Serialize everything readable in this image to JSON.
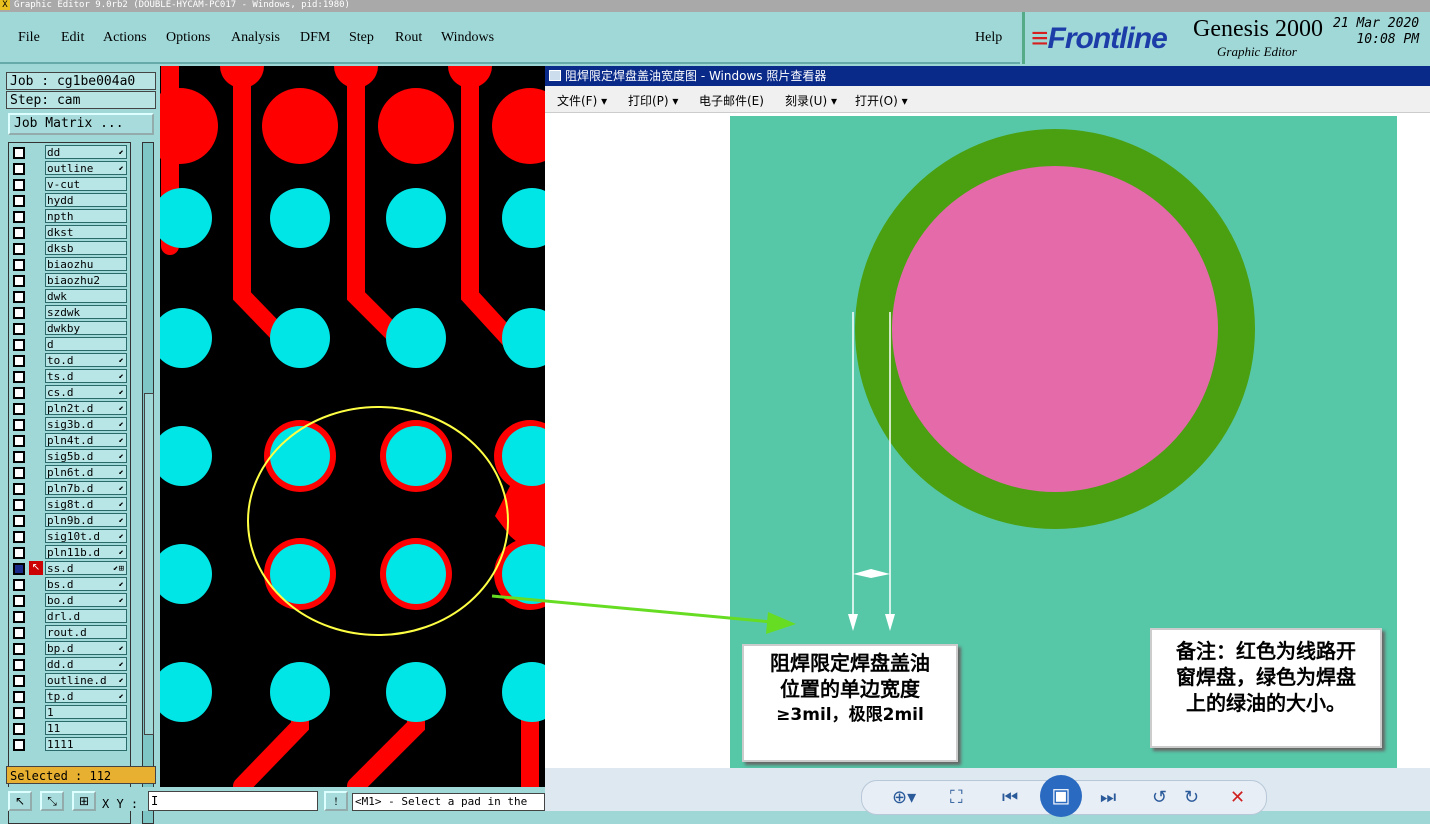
{
  "window": {
    "title": "Graphic Editor 9.0rb2 (DOUBLE-HYCAM-PC017 - Windows, pid:1980)",
    "app_icon_glyph": "X"
  },
  "menubar": {
    "items": [
      {
        "label": "File"
      },
      {
        "label": "Edit"
      },
      {
        "label": "Actions"
      },
      {
        "label": "Options"
      },
      {
        "label": "Analysis"
      },
      {
        "label": "DFM"
      },
      {
        "label": "Step"
      },
      {
        "label": "Rout"
      },
      {
        "label": "Windows"
      }
    ],
    "help": "Help"
  },
  "brand": {
    "logo": "Frontline",
    "product": "Genesis 2000",
    "subtitle": "Graphic Editor",
    "date": "21 Mar 2020",
    "time": "10:08 PM"
  },
  "leftpanel": {
    "job": "Job : cg1be004a0",
    "step": "Step: cam",
    "job_matrix_button": "Job Matrix ...",
    "selected": "Selected : 112",
    "layers": [
      {
        "name": "dd",
        "mark": "⬋"
      },
      {
        "name": "outline",
        "mark": "⬋"
      },
      {
        "name": "v-cut",
        "mark": ""
      },
      {
        "name": "hydd",
        "mark": ""
      },
      {
        "name": "npth",
        "mark": ""
      },
      {
        "name": "dkst",
        "mark": ""
      },
      {
        "name": "dksb",
        "mark": ""
      },
      {
        "name": "biaozhu",
        "mark": ""
      },
      {
        "name": "biaozhu2",
        "mark": ""
      },
      {
        "name": "dwk",
        "mark": ""
      },
      {
        "name": "szdwk",
        "mark": ""
      },
      {
        "name": "dwkby",
        "mark": ""
      },
      {
        "name": "d",
        "mark": ""
      },
      {
        "name": "to.d",
        "mark": "⬋"
      },
      {
        "name": "ts.d",
        "mark": "⬋"
      },
      {
        "name": "cs.d",
        "mark": "⬋"
      },
      {
        "name": "pln2t.d",
        "mark": "⬋"
      },
      {
        "name": "sig3b.d",
        "mark": "⬋"
      },
      {
        "name": "pln4t.d",
        "mark": "⬋"
      },
      {
        "name": "sig5b.d",
        "mark": "⬋"
      },
      {
        "name": "pln6t.d",
        "mark": "⬋"
      },
      {
        "name": "pln7b.d",
        "mark": "⬋"
      },
      {
        "name": "sig8t.d",
        "mark": "⬋"
      },
      {
        "name": "pln9b.d",
        "mark": "⬋"
      },
      {
        "name": "sig10t.d",
        "mark": "⬋"
      },
      {
        "name": "pln11b.d",
        "mark": "⬋"
      },
      {
        "name": "ss.d",
        "mark": "⬋⊞",
        "active": true
      },
      {
        "name": "bs.d",
        "mark": "⬋"
      },
      {
        "name": "bo.d",
        "mark": "⬋"
      },
      {
        "name": "drl.d",
        "mark": ""
      },
      {
        "name": "rout.d",
        "mark": ""
      },
      {
        "name": "bp.d",
        "mark": "⬋"
      },
      {
        "name": "dd.d",
        "mark": "⬋"
      },
      {
        "name": "outline.d",
        "mark": "⬋"
      },
      {
        "name": "tp.d",
        "mark": "⬋"
      },
      {
        "name": "1",
        "mark": ""
      },
      {
        "name": "11",
        "mark": ""
      },
      {
        "name": "1111",
        "mark": ""
      }
    ]
  },
  "bottombar": {
    "xy_label": "X Y :",
    "xy_value": "I",
    "status": "<M1> - Select a pad in the",
    "tool_icons": [
      "pointer-icon",
      "pan-icon",
      "grid-icon"
    ],
    "info_glyph": "!"
  },
  "viewer": {
    "title": "阻焊限定焊盘盖油宽度图 - Windows 照片查看器",
    "menu": [
      {
        "label": "文件(F)",
        "dropdown": true
      },
      {
        "label": "打印(P)",
        "dropdown": true
      },
      {
        "label": "电子邮件(E)",
        "dropdown": false
      },
      {
        "label": "刻录(U)",
        "dropdown": true
      },
      {
        "label": "打开(O)",
        "dropdown": true
      }
    ],
    "callout_left": [
      "阻焊限定焊盘盖油",
      "位置的单边宽度",
      "≥3mil，极限2mil"
    ],
    "callout_right": [
      "备注：红色为线路开",
      "窗焊盘，绿色为焊盘",
      "上的绿油的大小。"
    ],
    "colors": {
      "pad": "#e46aaa",
      "mask_ring": "#4aa010",
      "background": "#56c8a8"
    },
    "nav_icons": [
      "zoom-icon",
      "fit-icon",
      "previous-icon",
      "slideshow-icon",
      "next-icon",
      "rotate-ccw-icon",
      "rotate-cw-icon",
      "delete-icon"
    ]
  },
  "canvas": {
    "colors": {
      "background": "#000000",
      "trace": "#ff0000",
      "pad": "#00e5e5",
      "highlight": "#ffff44",
      "arrow": "#66dd22"
    }
  }
}
